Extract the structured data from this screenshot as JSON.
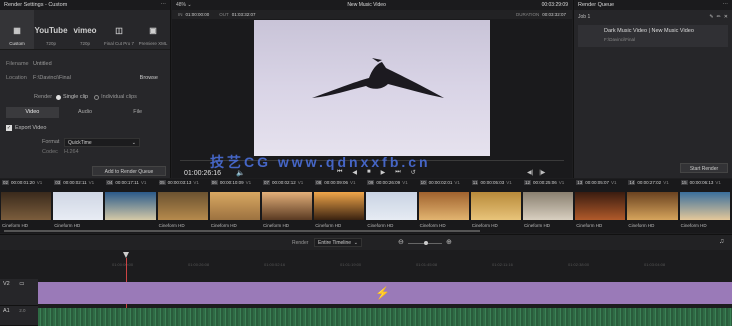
{
  "render_settings": {
    "title": "Render Settings - Custom",
    "presets": [
      {
        "label": "Custom",
        "icon": "custom-icon",
        "logo": ""
      },
      {
        "label": "720p",
        "icon": "youtube-icon",
        "logo": "YouTube"
      },
      {
        "label": "720p",
        "icon": "vimeo-icon",
        "logo": "vimeo"
      },
      {
        "label": "Final Cut Pro 7",
        "icon": "clapper-icon",
        "logo": ""
      },
      {
        "label": "Premiere XML",
        "icon": "xml-icon",
        "logo": ""
      }
    ],
    "filename_label": "Filename",
    "filename_value": "Untitled",
    "location_label": "Location",
    "location_value": "F:\\Davinci\\Final",
    "browse_label": "Browse",
    "render_label": "Render",
    "single_clip": "Single clip",
    "individual_clips": "Individual clips",
    "tabs": [
      "Video",
      "Audio",
      "File"
    ],
    "export_video": "Export Video",
    "format_label": "Format",
    "format_value": "QuickTime",
    "codec_label": "Codec",
    "codec_value": "H.264",
    "add_queue_label": "Add to Render Queue"
  },
  "viewer": {
    "zoom": "48%",
    "title": "New Music Video",
    "timecode_top": "00:03:29:09",
    "in_label": "IN",
    "in_value": "01:00:00:00",
    "out_label": "OUT",
    "out_value": "01:03:32:07",
    "duration_label": "DURATION",
    "duration_value": "00:03:32:07",
    "current_tc": "01:00:26:16",
    "watermark": "技艺CG  www.qdnxxfb.cn"
  },
  "render_queue": {
    "title": "Render Queue",
    "job_label": "Job 1",
    "job_name": "Dark Music Video | New Music Video",
    "job_path": "F:\\Davinci\\Final",
    "start_label": "Start Render"
  },
  "clips": [
    {
      "num": "02",
      "tc": "00:00:01:20",
      "track": "V1",
      "name": "Cineform HD",
      "thumb": [
        "#3a2a1c",
        "#7b5d3c"
      ]
    },
    {
      "num": "03",
      "tc": "00:00:02:11",
      "track": "V1",
      "name": "Cineform HD",
      "thumb": [
        "#cfd6e4",
        "#e8ecf4"
      ]
    },
    {
      "num": "04",
      "tc": "00:00:17:11",
      "track": "V1",
      "name": "",
      "thumb": [
        "#2b5a8a",
        "#d4c9a6"
      ]
    },
    {
      "num": "05",
      "tc": "00:00:03:13",
      "track": "V1",
      "name": "Cineform HD",
      "thumb": [
        "#6b5230",
        "#b68a4c"
      ]
    },
    {
      "num": "06",
      "tc": "00:00:10:09",
      "track": "V1",
      "name": "Cineform HD",
      "thumb": [
        "#d9a862",
        "#9c7240"
      ]
    },
    {
      "num": "07",
      "tc": "00:00:02:12",
      "track": "V1",
      "name": "Cineform HD",
      "thumb": [
        "#e4b07a",
        "#5a3a22"
      ]
    },
    {
      "num": "08",
      "tc": "00:00:09:06",
      "track": "V1",
      "name": "Cineform HD",
      "thumb": [
        "#f0a64a",
        "#3a2210"
      ]
    },
    {
      "num": "09",
      "tc": "00:00:26:09",
      "track": "V1",
      "name": "Cineform HD",
      "thumb": [
        "#c9d3e3",
        "#e6ebf3"
      ]
    },
    {
      "num": "10",
      "tc": "00:00:02:01",
      "track": "V1",
      "name": "Cineform HD",
      "thumb": [
        "#a0622e",
        "#e2b470"
      ]
    },
    {
      "num": "11",
      "tc": "00:00:05:03",
      "track": "V1",
      "name": "Cineform HD",
      "thumb": [
        "#b88a3a",
        "#e8c47a"
      ]
    },
    {
      "num": "12",
      "tc": "00:00:25:06",
      "track": "V1",
      "name": "Cineform HD",
      "thumb": [
        "#8a8070",
        "#d8cfc0"
      ]
    },
    {
      "num": "13",
      "tc": "00:00:05:07",
      "track": "V1",
      "name": "Cineform HD",
      "thumb": [
        "#3a1c10",
        "#b05a2a"
      ]
    },
    {
      "num": "14",
      "tc": "00:00:27:02",
      "track": "V1",
      "name": "Cineform HD",
      "thumb": [
        "#6a4220",
        "#d6a45c"
      ]
    },
    {
      "num": "15",
      "tc": "00:00:06:13",
      "track": "V1",
      "name": "Cineform HD",
      "thumb": [
        "#3a6f9c",
        "#e4c89a"
      ]
    }
  ],
  "timeline": {
    "render_label": "Render",
    "render_value": "Entire Timeline",
    "ruler": [
      "01:00:00:00",
      "01:00:26:08",
      "01:00:52:16",
      "01:01:19:00",
      "01:01:45:08",
      "01:02:11:16",
      "01:02:38:00",
      "01:03:04:08"
    ],
    "tracks": [
      {
        "name": "V2"
      },
      {
        "name": "A1",
        "level": "2.0"
      }
    ]
  },
  "colors": {
    "accent": "#e9873a",
    "clip": "#9a7ab8",
    "audio": "#2f6a44"
  }
}
